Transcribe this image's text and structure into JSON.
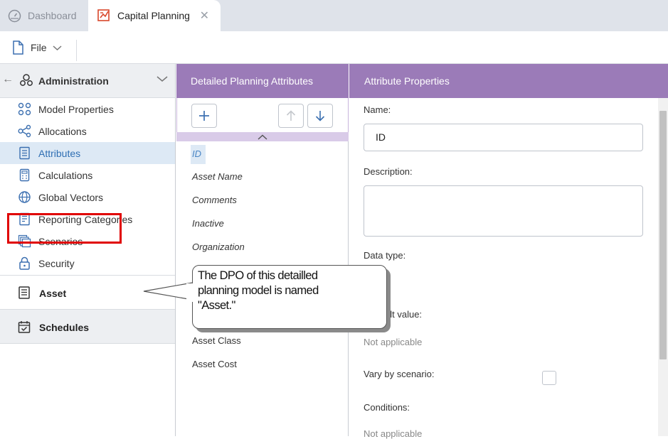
{
  "tabs": [
    {
      "label": "Dashboard",
      "icon": "dashboard-gauge-icon",
      "active": false
    },
    {
      "label": "Capital Planning",
      "icon": "capital-planning-icon",
      "active": true
    }
  ],
  "toolbar": {
    "file_label": "File"
  },
  "sidebar": {
    "section_title": "Administration",
    "items": [
      {
        "label": "Model Properties",
        "icon": "model-properties-icon",
        "active": false
      },
      {
        "label": "Allocations",
        "icon": "allocations-icon",
        "active": false
      },
      {
        "label": "Attributes",
        "icon": "attributes-icon",
        "active": true
      },
      {
        "label": "Calculations",
        "icon": "calculator-icon",
        "active": false
      },
      {
        "label": "Global Vectors",
        "icon": "globe-icon",
        "active": false
      },
      {
        "label": "Reporting Categories",
        "icon": "reporting-categories-icon",
        "active": false
      },
      {
        "label": "Scenarios",
        "icon": "scenarios-icon",
        "active": false
      },
      {
        "label": "Security",
        "icon": "lock-icon",
        "active": false
      }
    ],
    "asset_label": "Asset",
    "schedules_label": "Schedules"
  },
  "attributes_panel": {
    "title": "Detailed Planning Attributes",
    "items": [
      "ID",
      "Asset Name",
      "Comments",
      "Inactive",
      "Organization"
    ],
    "items_lower": [
      "Asset Class",
      "Asset Cost"
    ]
  },
  "properties_panel": {
    "title": "Attribute Properties",
    "name_label": "Name:",
    "name_value": "ID",
    "description_label": "Description:",
    "description_value": "",
    "data_type_label": "Data type:",
    "default_value_label_visible": "ult value:",
    "default_value": "Not applicable",
    "vary_label": "Vary by scenario:",
    "vary_checked": false,
    "conditions_label": "Conditions:",
    "conditions_value": "Not applicable"
  },
  "callout": {
    "line1": "The DPO of this detailled",
    "line2": "planning model is named",
    "line3": "\"Asset.\""
  },
  "colors": {
    "panel_header": "#9b7bb8",
    "active_item_bg": "#dde9f5",
    "active_item_text": "#2f6fb3",
    "highlight_box": "#e00000"
  }
}
